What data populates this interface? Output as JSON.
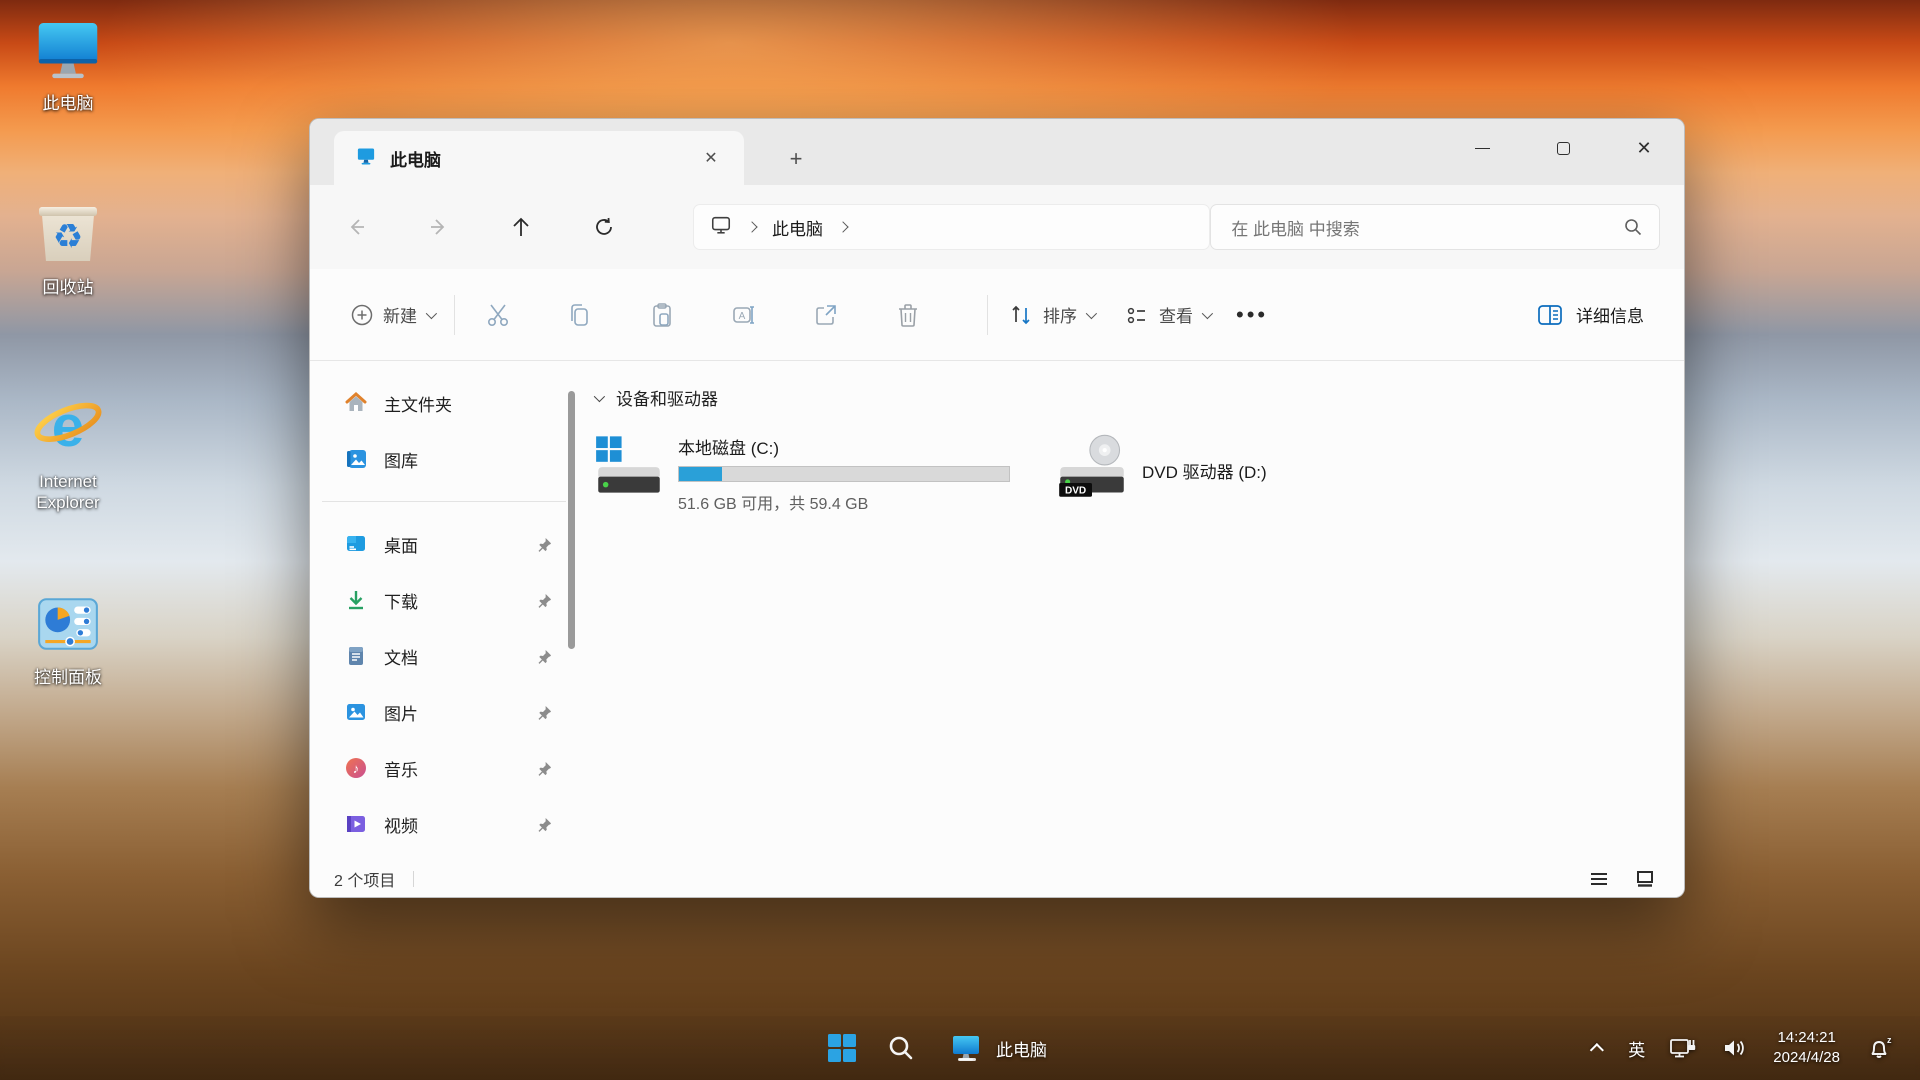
{
  "desktop": {
    "icons": [
      {
        "label": "此电脑"
      },
      {
        "label": "回收站"
      },
      {
        "label_line1": "Internet",
        "label_line2": "Explorer"
      },
      {
        "label": "控制面板"
      }
    ]
  },
  "window": {
    "tab": {
      "title": "此电脑"
    },
    "nav": {
      "breadcrumb_root": "此电脑",
      "search_placeholder": "在 此电脑 中搜索"
    },
    "toolbar": {
      "new_label": "新建",
      "sort_label": "排序",
      "view_label": "查看",
      "details_label": "详细信息"
    },
    "sidebar": {
      "top_items": [
        {
          "label": "主文件夹",
          "icon": "home-icon"
        },
        {
          "label": "图库",
          "icon": "gallery-icon"
        }
      ],
      "pinned_items": [
        {
          "label": "桌面",
          "icon": "desktop-folder-icon"
        },
        {
          "label": "下载",
          "icon": "downloads-icon"
        },
        {
          "label": "文档",
          "icon": "documents-icon"
        },
        {
          "label": "图片",
          "icon": "pictures-icon"
        },
        {
          "label": "音乐",
          "icon": "music-icon"
        },
        {
          "label": "视频",
          "icon": "videos-icon"
        }
      ]
    },
    "content": {
      "group_header": "设备和驱动器",
      "drives": [
        {
          "name": "本地磁盘 (C:)",
          "detail": "51.6 GB 可用，共 59.4 GB",
          "used_percent": 13
        },
        {
          "name": "DVD 驱动器 (D:)",
          "badge": "DVD"
        }
      ]
    },
    "statusbar": {
      "count": "2 个项目"
    }
  },
  "taskbar": {
    "app_label": "此电脑",
    "tray": {
      "ime": "英",
      "time": "14:24:21",
      "date": "2024/4/28"
    }
  },
  "glyphs": {
    "close": "✕",
    "plus": "+",
    "more": "•••",
    "recycle": "♻",
    "music_note": "♪"
  },
  "colors": {
    "accent_blue": "#2aa0d8",
    "windows_logo_blue": "#2ba3e3",
    "drive_led_green": "#49d149",
    "titlebar_gray": "#e9e9e9",
    "window_bg": "#fcfcfc",
    "disabled_tool_icon": "#8fa8bf"
  }
}
